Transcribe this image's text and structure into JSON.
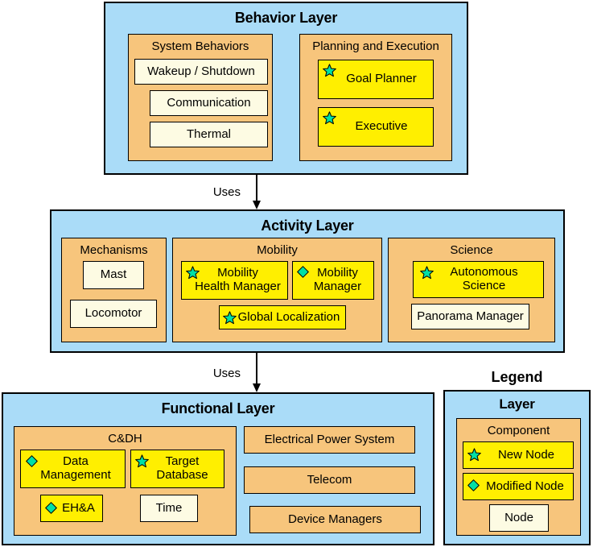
{
  "diagram": {
    "title_behavior": "Behavior Layer",
    "title_activity": "Activity Layer",
    "title_functional": "Functional Layer",
    "legend_title": "Legend",
    "uses_label_1": "Uses",
    "uses_label_2": "Uses"
  },
  "colors": {
    "layer_bg": "#aadcf8",
    "group_bg": "#f7c57c",
    "node_bg": "#fdfbe3",
    "marked_node_bg": "#ffef00",
    "badge_fill": "#00e0a5",
    "stroke": "#000000",
    "page_bg": "#ffffff"
  },
  "behavior_layer": {
    "title": "Behavior Layer",
    "groups": [
      {
        "title": "System Behaviors",
        "nodes": [
          {
            "label": "Wakeup / Shutdown",
            "badge": "none"
          },
          {
            "label": "Communication",
            "badge": "none"
          },
          {
            "label": "Thermal",
            "badge": "none"
          }
        ]
      },
      {
        "title": "Planning and Execution",
        "nodes": [
          {
            "label": "Goal Planner",
            "badge": "star"
          },
          {
            "label": "Executive",
            "badge": "star"
          }
        ]
      }
    ]
  },
  "activity_layer": {
    "title": "Activity Layer",
    "groups": [
      {
        "title": "Mechanisms",
        "nodes": [
          {
            "label": "Mast",
            "badge": "none"
          },
          {
            "label": "Locomotor",
            "badge": "none"
          }
        ]
      },
      {
        "title": "Mobility",
        "nodes": [
          {
            "label": "Mobility\nHealth Manager",
            "badge": "star"
          },
          {
            "label": "Mobility\nManager",
            "badge": "diamond"
          },
          {
            "label": "Global Localization",
            "badge": "star"
          }
        ]
      },
      {
        "title": "Science",
        "nodes": [
          {
            "label": "Autonomous\nScience",
            "badge": "star"
          },
          {
            "label": "Panorama Manager",
            "badge": "none"
          }
        ]
      }
    ]
  },
  "functional_layer": {
    "title": "Functional Layer",
    "groups": [
      {
        "title": "C&DH",
        "nodes": [
          {
            "label": "Data\nManagement",
            "badge": "diamond"
          },
          {
            "label": "Target\nDatabase",
            "badge": "star"
          },
          {
            "label": "EH&A",
            "badge": "diamond"
          },
          {
            "label": "Time",
            "badge": "none"
          }
        ]
      }
    ],
    "bars": [
      {
        "label": "Electrical Power System"
      },
      {
        "label": "Telecom"
      },
      {
        "label": "Device Managers"
      }
    ]
  },
  "legend": {
    "title": "Legend",
    "layer_label": "Layer",
    "component_label": "Component",
    "items": [
      {
        "label": "New Node",
        "badge": "star",
        "style": "marked"
      },
      {
        "label": "Modified Node",
        "badge": "diamond",
        "style": "marked"
      },
      {
        "label": "Node",
        "badge": "none",
        "style": "plain"
      }
    ]
  }
}
